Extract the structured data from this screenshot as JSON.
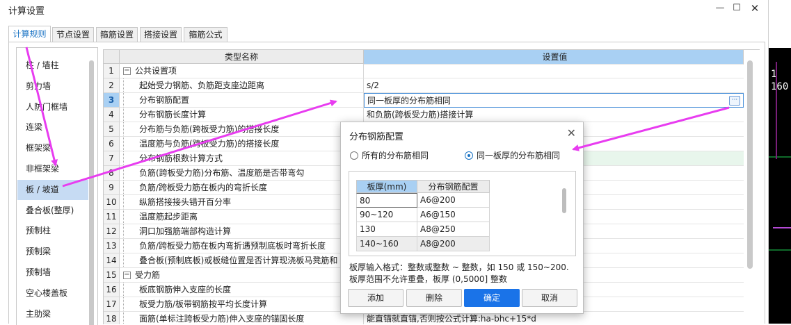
{
  "window": {
    "title": "计算设置"
  },
  "tabs": [
    "计算规则",
    "节点设置",
    "箍筋设置",
    "搭接设置",
    "箍筋公式"
  ],
  "sidebar": {
    "items": [
      "柱 / 墙柱",
      "剪力墙",
      "人防门框墙",
      "连梁",
      "框架梁",
      "非框架梁",
      "板 / 坡道",
      "叠合板(整厚)",
      "预制柱",
      "预制梁",
      "预制墙",
      "空心楼盖板",
      "主肋梁"
    ],
    "selected": 6
  },
  "grid": {
    "headers": {
      "name": "类型名称",
      "value": "设置值"
    },
    "rows": [
      {
        "n": "1",
        "name": "公共设置项",
        "value": "",
        "group": true
      },
      {
        "n": "2",
        "name": "起始受力钢筋、负筋距支座边距离",
        "value": "s/2"
      },
      {
        "n": "3",
        "name": "分布钢筋配置",
        "value": "同一板厚的分布筋相同",
        "current": true
      },
      {
        "n": "4",
        "name": "分布钢筋长度计算",
        "value": "和负筋(跨板受力筋)搭接计算"
      },
      {
        "n": "5",
        "name": "分布筋与负筋(跨板受力筋)的搭接长度",
        "value": ""
      },
      {
        "n": "6",
        "name": "温度筋与负筋(跨板受力筋)的搭接长度",
        "value": ""
      },
      {
        "n": "7",
        "name": "分布钢筋根数计算方式",
        "value": "",
        "highlight": true
      },
      {
        "n": "8",
        "name": "负筋(跨板受力筋)分布筋、温度筋是否带弯勾",
        "value": ""
      },
      {
        "n": "9",
        "name": "负筋/跨板受力筋在板内的弯折长度",
        "value": ""
      },
      {
        "n": "10",
        "name": "纵筋搭接接头错开百分率",
        "value": ""
      },
      {
        "n": "11",
        "name": "温度筋起步距离",
        "value": ""
      },
      {
        "n": "12",
        "name": "洞口加强筋端部构造计算",
        "value": ""
      },
      {
        "n": "13",
        "name": "负筋/跨板受力筋在板内弯折遇预制底板时弯折长度",
        "value": ""
      },
      {
        "n": "14",
        "name": "叠合板(预制底板)或板缝位置是否计算现浇板马凳筋和",
        "value": ""
      },
      {
        "n": "15",
        "name": "受力筋",
        "value": "",
        "group": true
      },
      {
        "n": "16",
        "name": "板底钢筋伸入支座的长度",
        "value": ""
      },
      {
        "n": "17",
        "name": "板受力筋/板带钢筋按平均长度计算",
        "value": ""
      },
      {
        "n": "18",
        "name": "面筋(单标注跨板受力筋)伸入支座的锚固长度",
        "value": "能直锚就直锚,否则按公式计算:ha-bhc+15*d"
      }
    ]
  },
  "cad": {
    "lines": [
      "1",
      "160"
    ]
  },
  "dialog": {
    "title": "分布钢筋配置",
    "options": [
      "所有的分布筋相同",
      "同一板厚的分布筋相同"
    ],
    "selected_option": 1,
    "table": {
      "headers": [
        "板厚(mm)",
        "分布钢筋配置"
      ],
      "rows": [
        [
          "80",
          "A6@200"
        ],
        [
          "90~120",
          "A6@150"
        ],
        [
          "130",
          "A8@250"
        ],
        [
          "140~160",
          "A8@200"
        ]
      ]
    },
    "help": [
      "板厚输入格式：整数或整数 ~ 整数，如 150 或 150~200.",
      "板厚范围不允许重叠，板厚 (0,5000] 整数"
    ],
    "buttons": {
      "add": "添加",
      "delete": "删除",
      "ok": "确定",
      "cancel": "取消"
    }
  },
  "colors": {
    "accent": "#1a73e8",
    "annotation_arrow": "#e83cf0",
    "header_blue": "#a9d0f3"
  }
}
